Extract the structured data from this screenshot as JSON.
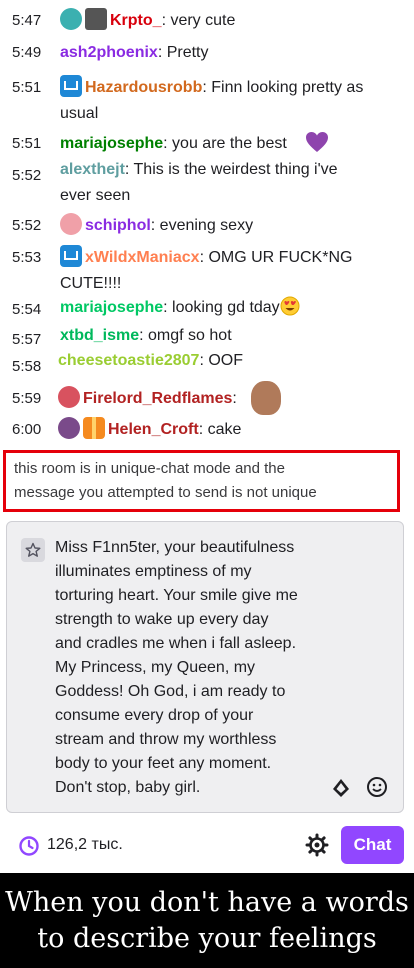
{
  "colors": {
    "accent": "#9147ff",
    "notice_border": "#e5000a"
  },
  "messages": [
    {
      "time": "5:47",
      "badges": [
        "teal-avatar-badge",
        "box-badge"
      ],
      "user": "Krpto_",
      "user_color": "#d8000c",
      "text": "very cute"
    },
    {
      "time": "5:49",
      "badges": [],
      "user": "ash2phoenix",
      "user_color": "#8a2be2",
      "text": "Pretty"
    },
    {
      "time": "5:51",
      "badges": [
        "prime-badge"
      ],
      "user": "Hazardousrobb",
      "user_color": "#d2691e",
      "text_line1": "Finn looking pretty as",
      "text_line2": "usual"
    },
    {
      "time": "5:51",
      "badges": [],
      "user": "mariajosephe",
      "user_color": "#008000",
      "text": "you are the best",
      "emote": "purple-heart"
    },
    {
      "time": "5:52",
      "badges": [],
      "user": "alexthejt",
      "user_color": "#5f9ea0",
      "text_line1": "This is the weirdest thing i've",
      "text_line2": "ever seen"
    },
    {
      "time": "5:52",
      "badges": [
        "pink-avatar-badge"
      ],
      "user": "schiphol",
      "user_color": "#8a2be2",
      "text": "evening sexy"
    },
    {
      "time": "5:53",
      "badges": [
        "prime-badge"
      ],
      "user": "xWildxManiacx",
      "user_color": "#ff7f50",
      "text_line1": "OMG UR FUCK*NG",
      "text_line2": "CUTE!!!!"
    },
    {
      "time": "5:54",
      "badges": [],
      "user": "mariajosephe",
      "user_color": "#00c864",
      "text": "looking gd tday",
      "emote": "heart-eyes"
    },
    {
      "time": "5:57",
      "badges": [],
      "user": "xtbd_isme",
      "user_color": "#00b85c",
      "text": "omgf so hot"
    },
    {
      "time": "5:58",
      "badges": [],
      "user": "cheesetoastie2807",
      "user_color": "#9acd32",
      "text": "OOF"
    },
    {
      "time": "5:59",
      "badges": [
        "red-avatar-badge"
      ],
      "user": "Firelord_Redflames",
      "user_color": "#b22222",
      "text": "",
      "emote": "face-emote"
    },
    {
      "time": "6:00",
      "badges": [
        "purple-avatar-badge",
        "gift-badge"
      ],
      "user": "Helen_Croft",
      "user_color": "#b22222",
      "text": "cake"
    }
  ],
  "notice": {
    "line1": "this room is in unique-chat mode and the",
    "line2": "message you attempted to send is not unique"
  },
  "composer": {
    "lines": [
      "Miss F1nn5ter, your beautifulness",
      "illuminates emptiness of my",
      "torturing heart. Your smile give me",
      "strength to wake up every day",
      "and cradles me when i fall asleep.",
      "My Princess, my Queen, my",
      "Goddess! Oh God, i am ready to",
      "consume every drop of your",
      "stream and throw my worthless",
      "body to your feet any moment.",
      "Don't stop, baby girl."
    ]
  },
  "footer": {
    "viewers": "126,2 тыс.",
    "chat_label": "Chat"
  },
  "caption": {
    "line1": "When you don't have a words",
    "line2": "to describe your feelings"
  }
}
